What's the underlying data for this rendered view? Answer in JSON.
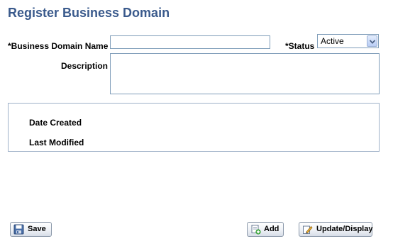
{
  "page": {
    "title": "Register Business Domain"
  },
  "form": {
    "business_domain_name_label": "*Business Domain Name",
    "business_domain_name_value": "",
    "status_label": "*Status",
    "status_value": "Active",
    "description_label": "Description",
    "description_value": ""
  },
  "info": {
    "date_created_label": "Date Created",
    "last_modified_label": "Last Modified"
  },
  "buttons": {
    "save_label": "Save",
    "add_label": "Add",
    "update_display_label": "Update/Display"
  },
  "icons": {
    "save": "save-disk-icon",
    "add": "add-document-icon",
    "update_display": "edit-pencil-icon",
    "dropdown": "chevron-down-icon"
  },
  "colors": {
    "title": "#3a5a8c",
    "input_border": "#7f9db9",
    "box_border": "#9fb1c8",
    "add_plus": "#2e9e2e"
  }
}
